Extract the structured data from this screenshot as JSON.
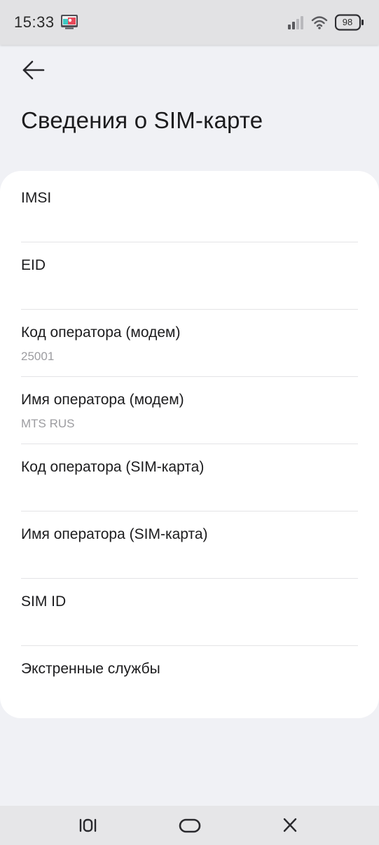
{
  "status_bar": {
    "time": "15:33",
    "battery_level": "98",
    "icons": [
      "notification-icon",
      "signal-icon",
      "wifi-icon",
      "battery-icon"
    ]
  },
  "header": {
    "back_icon": "arrow-left-icon",
    "title": "Сведения о SIM-карте"
  },
  "rows": [
    {
      "title": "IMSI",
      "value": ""
    },
    {
      "title": "EID",
      "value": ""
    },
    {
      "title": "Код оператора (модем)",
      "value": "25001"
    },
    {
      "title": "Имя оператора (модем)",
      "value": "MTS RUS"
    },
    {
      "title": "Код оператора (SIM-карта)",
      "value": ""
    },
    {
      "title": "Имя оператора (SIM-карта)",
      "value": ""
    },
    {
      "title": "SIM ID",
      "value": ""
    },
    {
      "title": "Экстренные службы",
      "value": ""
    }
  ],
  "nav_bar": {
    "icons": [
      "recents-icon",
      "home-icon",
      "back-close-icon"
    ]
  },
  "colors": {
    "background": "#f0f1f5",
    "card": "#ffffff",
    "primary_text": "#1c1c1e",
    "secondary_text": "#9c9ca0",
    "divider": "#e4e4e6"
  }
}
